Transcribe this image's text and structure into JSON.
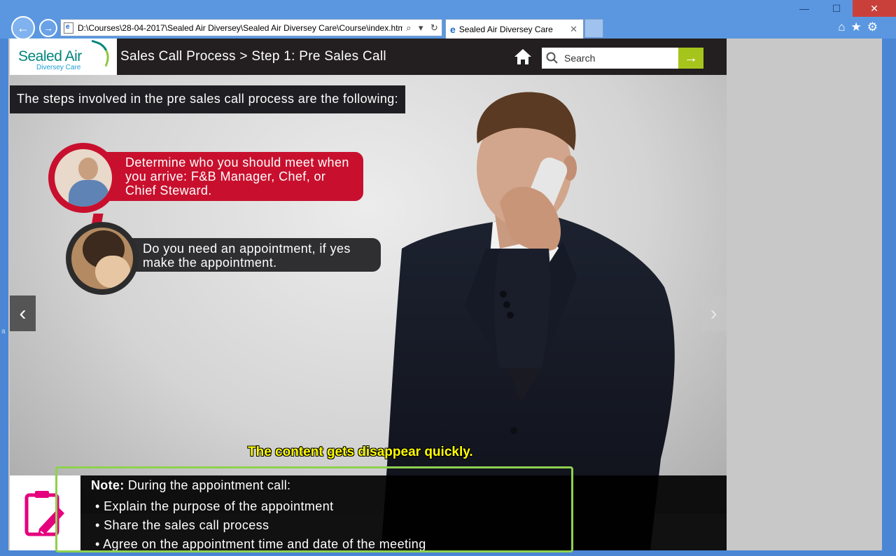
{
  "browser": {
    "address_url": "D:\\Courses\\28-04-2017\\Sealed Air Diversey\\Sealed Air Diversey Care\\Course\\index.html",
    "tab_title": "Sealed Air Diversey Care",
    "window_buttons": {
      "minimize": "—",
      "maximize": "☐",
      "close": "✕"
    },
    "nav": {
      "back_icon": "back-arrow-icon",
      "forward_icon": "forward-arrow-icon"
    },
    "toolbar_icons": [
      "home-icon",
      "star-icon",
      "gear-icon"
    ]
  },
  "header": {
    "logo_name": "Sealed Air",
    "logo_sub": "Diversey Care",
    "title": "Sales Call Process > Step 1: Pre Sales Call",
    "search_placeholder": "Search",
    "search_go_icon": "→"
  },
  "content": {
    "intro": "The steps involved in the pre sales call process are the following:",
    "steps": [
      {
        "text": "Determine who you should meet when you arrive: F&B Manager, Chef, or Chief Steward.",
        "color": "#c8102e"
      },
      {
        "text": "Do you need an appointment, if yes make the appointment.",
        "color": "#2f2f31"
      }
    ],
    "nav_prev": "‹",
    "nav_next": "›",
    "warning": "The content gets disappear quickly."
  },
  "note": {
    "label": "Note:",
    "title": "During the appointment call:",
    "items": [
      "Explain the purpose of the appointment",
      "Share the sales call process",
      "Agree on the appointment time and date of the meeting"
    ],
    "highlight_color": "#8fd14f"
  },
  "colors": {
    "brand_red": "#c8102e",
    "accent_green": "#a6c51c",
    "header_dark": "#231f20"
  }
}
